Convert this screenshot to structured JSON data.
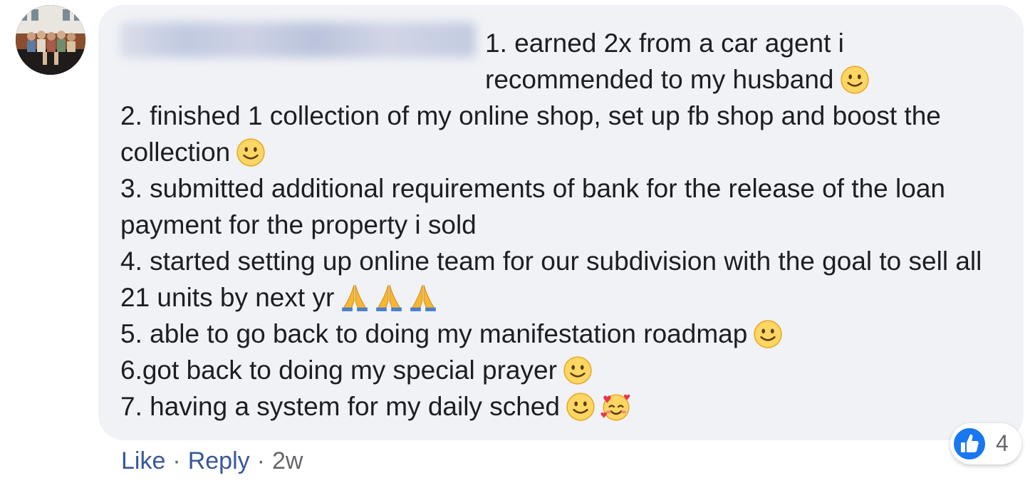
{
  "comment": {
    "lines": [
      "1. earned 2x from a car agent i recommended to my husband",
      "2. finished 1 collection of my online shop, set up fb shop and boost the collection",
      "3. submitted additional requirements of bank for the release of the loan payment for the property i sold",
      "4. started setting up online team for our subdivision with the goal to sell all 21 units by next yr",
      "5. able to go back to doing my manifestation roadmap",
      "6.got back to doing my special prayer",
      "7. having a system for my daily sched"
    ]
  },
  "actions": {
    "like_label": "Like",
    "reply_label": "Reply",
    "separator": "·",
    "timestamp": "2w"
  },
  "reactions": {
    "icon": "like-thumb-icon",
    "count": "4",
    "color": "#1877f2"
  }
}
